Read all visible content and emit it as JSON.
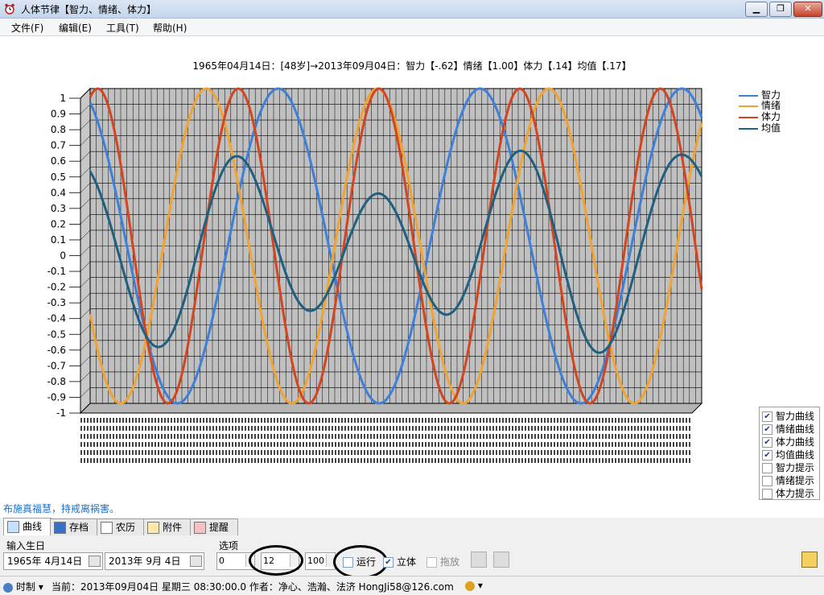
{
  "window": {
    "title": "人体节律【智力、情绪、体力】",
    "controls": {
      "minimize": "▁",
      "maximize": "❐",
      "close": "✕"
    }
  },
  "menu": [
    {
      "label": "文件(F)"
    },
    {
      "label": "编辑(E)"
    },
    {
      "label": "工具(T)"
    },
    {
      "label": "帮助(H)"
    }
  ],
  "chart_data": {
    "type": "line",
    "title": "1965年04月14日：[48岁]→2013年09月04日：智力【-.62】情绪【1.00】体力【.14】均值【.17】",
    "xlabel": "",
    "ylabel": "",
    "ylim": [
      -1,
      1
    ],
    "yticks": [
      "1",
      "0.9",
      "0.8",
      "0.7",
      "0.6",
      "0.5",
      "0.4",
      "0.3",
      "0.2",
      "0.1",
      "0",
      "-0.1",
      "-0.2",
      "-0.3",
      "-0.4",
      "-0.5",
      "-0.6",
      "-0.7",
      "-0.8",
      "-0.9",
      "-1"
    ],
    "grid": true,
    "three_d": true,
    "legend_position": "top-right",
    "x_day_range": [
      -19,
      81
    ],
    "series": [
      {
        "name": "智力",
        "period_days": 33,
        "value_at_day0": -0.62,
        "color": "#3e7fd8"
      },
      {
        "name": "情绪",
        "period_days": 28,
        "value_at_day0": 1.0,
        "color": "#f0a330"
      },
      {
        "name": "体力",
        "period_days": 23,
        "value_at_day0": 0.14,
        "color": "#d2451e"
      },
      {
        "name": "均值",
        "derived": "mean",
        "value_at_day0": 0.17,
        "color": "#1f5f80"
      }
    ]
  },
  "side_options": [
    {
      "label": "智力曲线",
      "checked": true
    },
    {
      "label": "情绪曲线",
      "checked": true
    },
    {
      "label": "体力曲线",
      "checked": true
    },
    {
      "label": "均值曲线",
      "checked": true
    },
    {
      "label": "智力提示",
      "checked": false
    },
    {
      "label": "情绪提示",
      "checked": false
    },
    {
      "label": "体力提示",
      "checked": false
    }
  ],
  "motto": "布施真福慧，持戒离祸害。",
  "tabs": [
    {
      "label": "曲线",
      "active": true
    },
    {
      "label": "存档",
      "active": false
    },
    {
      "label": "农历",
      "active": false
    },
    {
      "label": "附件",
      "active": false
    },
    {
      "label": "提醒",
      "active": false
    }
  ],
  "panel": {
    "birth_label": "输入生日",
    "birth_date": "1965年  4月14日",
    "target_date": "2013年  9月  4日",
    "options_label": "选项",
    "spin1": "0",
    "spin2": "12",
    "spin3": "100",
    "run_label": "运行",
    "run_checked": false,
    "stereo_label": "立体",
    "stereo_checked": true,
    "drag_label": "拖放",
    "drag_checked": false
  },
  "status": {
    "mode": "时制",
    "text": "当前：2013年09月04日 星期三 08:30:00.0  作者：净心、浩瀚、法济  HongJi58@126.com"
  }
}
